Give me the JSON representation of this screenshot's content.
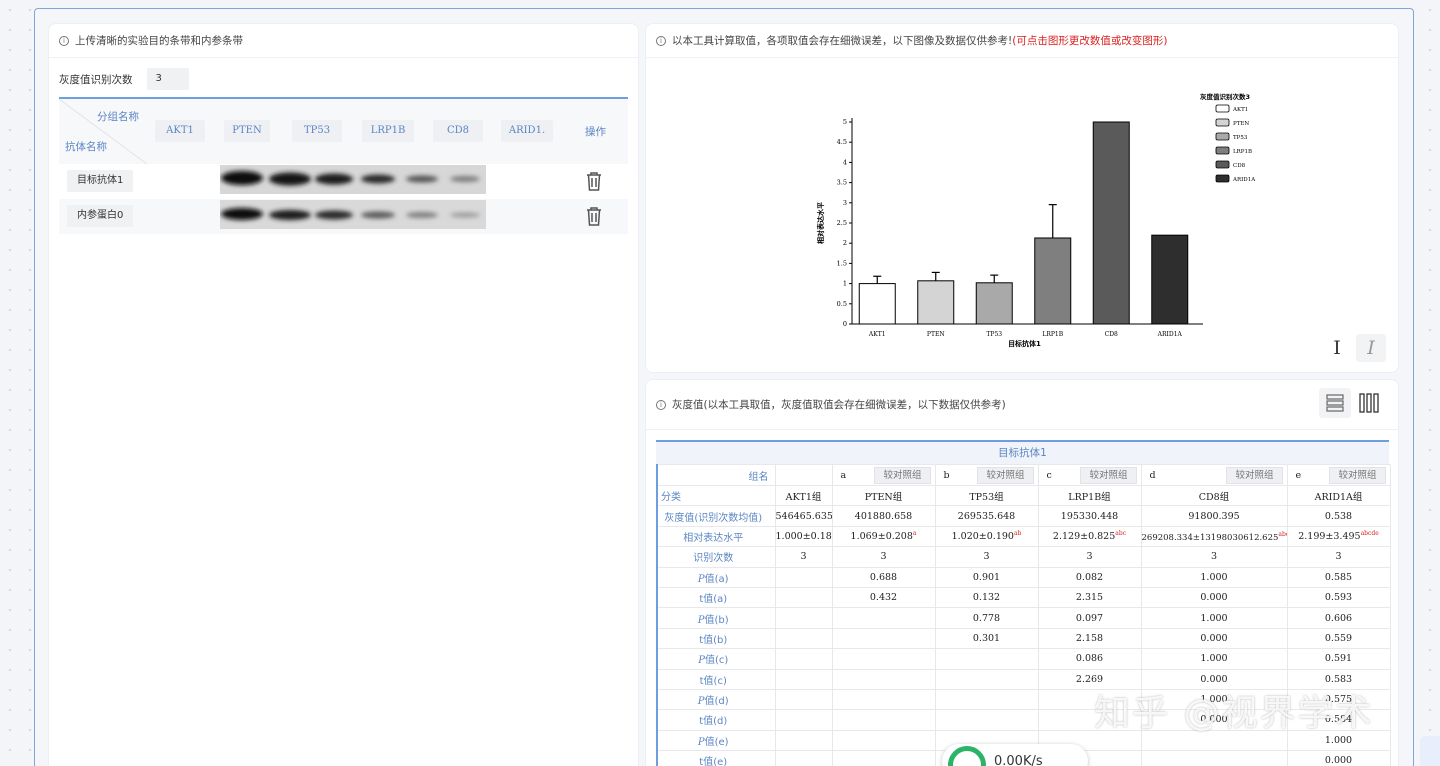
{
  "left_panel": {
    "title": "上传清晰的实验目的条带和内参条带",
    "count_label": "灰度值识别次数",
    "count_value": "3",
    "header_top": "分组名称",
    "header_bottom": "抗体名称",
    "columns": [
      "AKT1",
      "PTEN",
      "TP53",
      "LRP1B",
      "CD8",
      "ARID1."
    ],
    "op_label": "操作",
    "rows": [
      "目标抗体1",
      "内参蛋白0"
    ]
  },
  "chart_panel": {
    "title": "以本工具计算取值，各项取值会存在细微误差，以下图像及数据仅供参考!",
    "title_note": "(可点击图形更改数值或改变图形)",
    "tool_upright": "I",
    "tool_italic": "I"
  },
  "chart_data": {
    "type": "bar",
    "categories": [
      "AKT1",
      "PTEN",
      "TP53",
      "LRP1B",
      "CD8",
      "ARID1A"
    ],
    "values": [
      1.0,
      1.069,
      1.02,
      2.129,
      5.0,
      2.199
    ],
    "errors": [
      0.182,
      0.208,
      0.19,
      0.825,
      0,
      0
    ],
    "colors": [
      "#ffffff",
      "#d4d4d4",
      "#a9a9a9",
      "#7f7f7f",
      "#5a5a5a",
      "#2e2e2e"
    ],
    "ylim": [
      0,
      5
    ],
    "yticks": [
      "0",
      "0.5",
      "1",
      "1.5",
      "2",
      "2.5",
      "3",
      "3.5",
      "4",
      "4.5",
      "5"
    ],
    "xlabel": "目标抗体1",
    "ylabel": "相对表达水平",
    "legend_title": "灰度值识别次数3",
    "legend": [
      "AKT1",
      "PTEN",
      "TP53",
      "LRP1B",
      "CD8",
      "ARID1A"
    ]
  },
  "data_panel": {
    "title": "灰度值(以本工具取值，灰度值取值会存在细微误差，以下数据仅供参考)",
    "table_title": "目标抗体1",
    "header_group": "组名",
    "header_cat": "分类",
    "ref_label": "较对照组",
    "letters": [
      "a",
      "b",
      "c",
      "d",
      "e"
    ],
    "groups": [
      "AKT1组",
      "PTEN组",
      "TP53组",
      "LRP1B组",
      "CD8组",
      "ARID1A组"
    ],
    "rows": [
      {
        "label": "灰度值(识别次数均值)",
        "cells": [
          "546465.635",
          "401880.658",
          "269535.648",
          "195330.448",
          "91800.395",
          "0.538"
        ]
      },
      {
        "label": "相对表达水平",
        "cells": [
          "1.000±0.182",
          "1.069±0.208",
          "1.020±0.190",
          "2.129±0.825",
          "269208.334±13198030612.625",
          "2.199±3.495"
        ],
        "sig": [
          "",
          "a",
          "ab",
          "abc",
          "abcd",
          "abcde"
        ]
      },
      {
        "label": "识别次数",
        "cells": [
          "3",
          "3",
          "3",
          "3",
          "3",
          "3"
        ]
      },
      {
        "label": "P值(a)",
        "cells": [
          "",
          "0.688",
          "0.901",
          "0.082",
          "1.000",
          "0.585"
        ]
      },
      {
        "label": "t值(a)",
        "cells": [
          "",
          "0.432",
          "0.132",
          "2.315",
          "0.000",
          "0.593"
        ]
      },
      {
        "label": "P值(b)",
        "cells": [
          "",
          "",
          "0.778",
          "0.097",
          "1.000",
          "0.606"
        ]
      },
      {
        "label": "t值(b)",
        "cells": [
          "",
          "",
          "0.301",
          "2.158",
          "0.000",
          "0.559"
        ]
      },
      {
        "label": "P值(c)",
        "cells": [
          "",
          "",
          "",
          "0.086",
          "1.000",
          "0.591"
        ]
      },
      {
        "label": "t值(c)",
        "cells": [
          "",
          "",
          "",
          "2.269",
          "0.000",
          "0.583"
        ]
      },
      {
        "label": "P值(d)",
        "cells": [
          "",
          "",
          "",
          "",
          "1.000",
          "0.575"
        ]
      },
      {
        "label": "t值(d)",
        "cells": [
          "",
          "",
          "",
          "",
          "0.000",
          "0.584"
        ]
      },
      {
        "label": "P值(e)",
        "cells": [
          "",
          "",
          "",
          "",
          "",
          "1.000"
        ]
      },
      {
        "label": "t值(e)",
        "cells": [
          "",
          "",
          "",
          "",
          "",
          "0.000"
        ]
      }
    ]
  },
  "overlay": {
    "watermark": "知乎 @视界学术",
    "speed_text": "0.00K/s"
  }
}
